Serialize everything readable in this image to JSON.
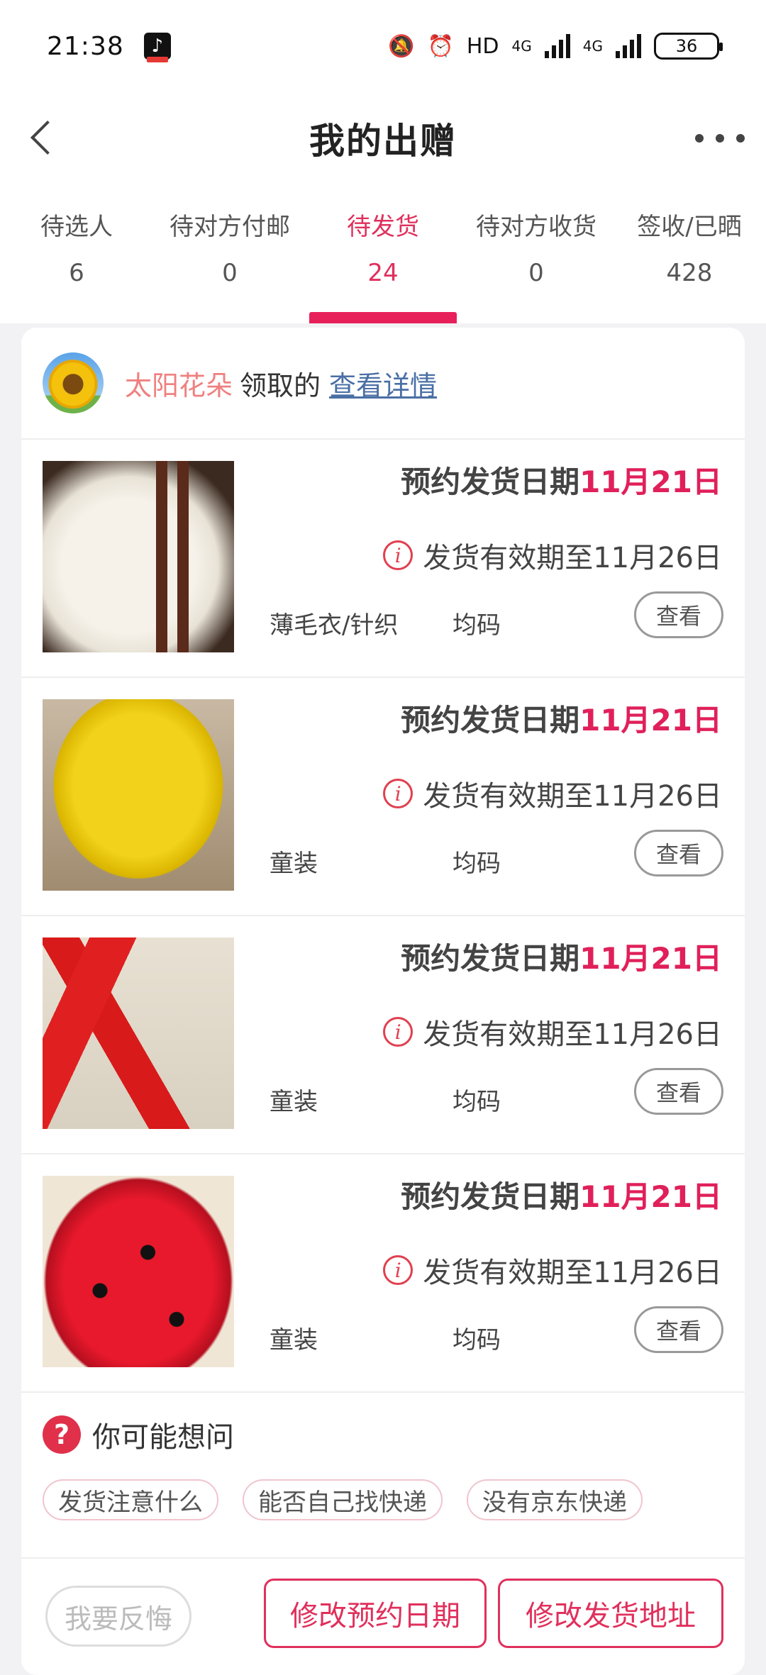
{
  "status_bar": {
    "time": "21:38",
    "hd": "HD",
    "network_1": "4G",
    "network_2": "4G",
    "battery": "36"
  },
  "header": {
    "title": "我的出赠"
  },
  "tabs": [
    {
      "label": "待选人",
      "count": "6"
    },
    {
      "label": "待对方付邮",
      "count": "0"
    },
    {
      "label": "待发货",
      "count": "24"
    },
    {
      "label": "待对方收货",
      "count": "0"
    },
    {
      "label": "签收/已晒",
      "count": "428"
    }
  ],
  "active_tab_index": 2,
  "recipient": {
    "name": "太阳花朵",
    "suffix": "领取的",
    "detail_link": "查看详情"
  },
  "items": [
    {
      "ship_label": "预约发货日期",
      "ship_date": "11月21日",
      "validity": "发货有效期至11月26日",
      "category": "薄毛衣/针织",
      "size": "均码",
      "view_label": "查看"
    },
    {
      "ship_label": "预约发货日期",
      "ship_date": "11月21日",
      "validity": "发货有效期至11月26日",
      "category": "童装",
      "size": "均码",
      "view_label": "查看"
    },
    {
      "ship_label": "预约发货日期",
      "ship_date": "11月21日",
      "validity": "发货有效期至11月26日",
      "category": "童装",
      "size": "均码",
      "view_label": "查看"
    },
    {
      "ship_label": "预约发货日期",
      "ship_date": "11月21日",
      "validity": "发货有效期至11月26日",
      "category": "童装",
      "size": "均码",
      "view_label": "查看"
    }
  ],
  "faq": {
    "title": "你可能想问",
    "chips": [
      "发货注意什么",
      "能否自己找快递",
      "没有京东快递"
    ]
  },
  "actions": {
    "regret": "我要反悔",
    "change_date": "修改预约日期",
    "change_address": "修改发货地址"
  },
  "colors": {
    "accent": "#e0305c",
    "recipient_name": "#f08080",
    "link": "#4a6fa5"
  }
}
